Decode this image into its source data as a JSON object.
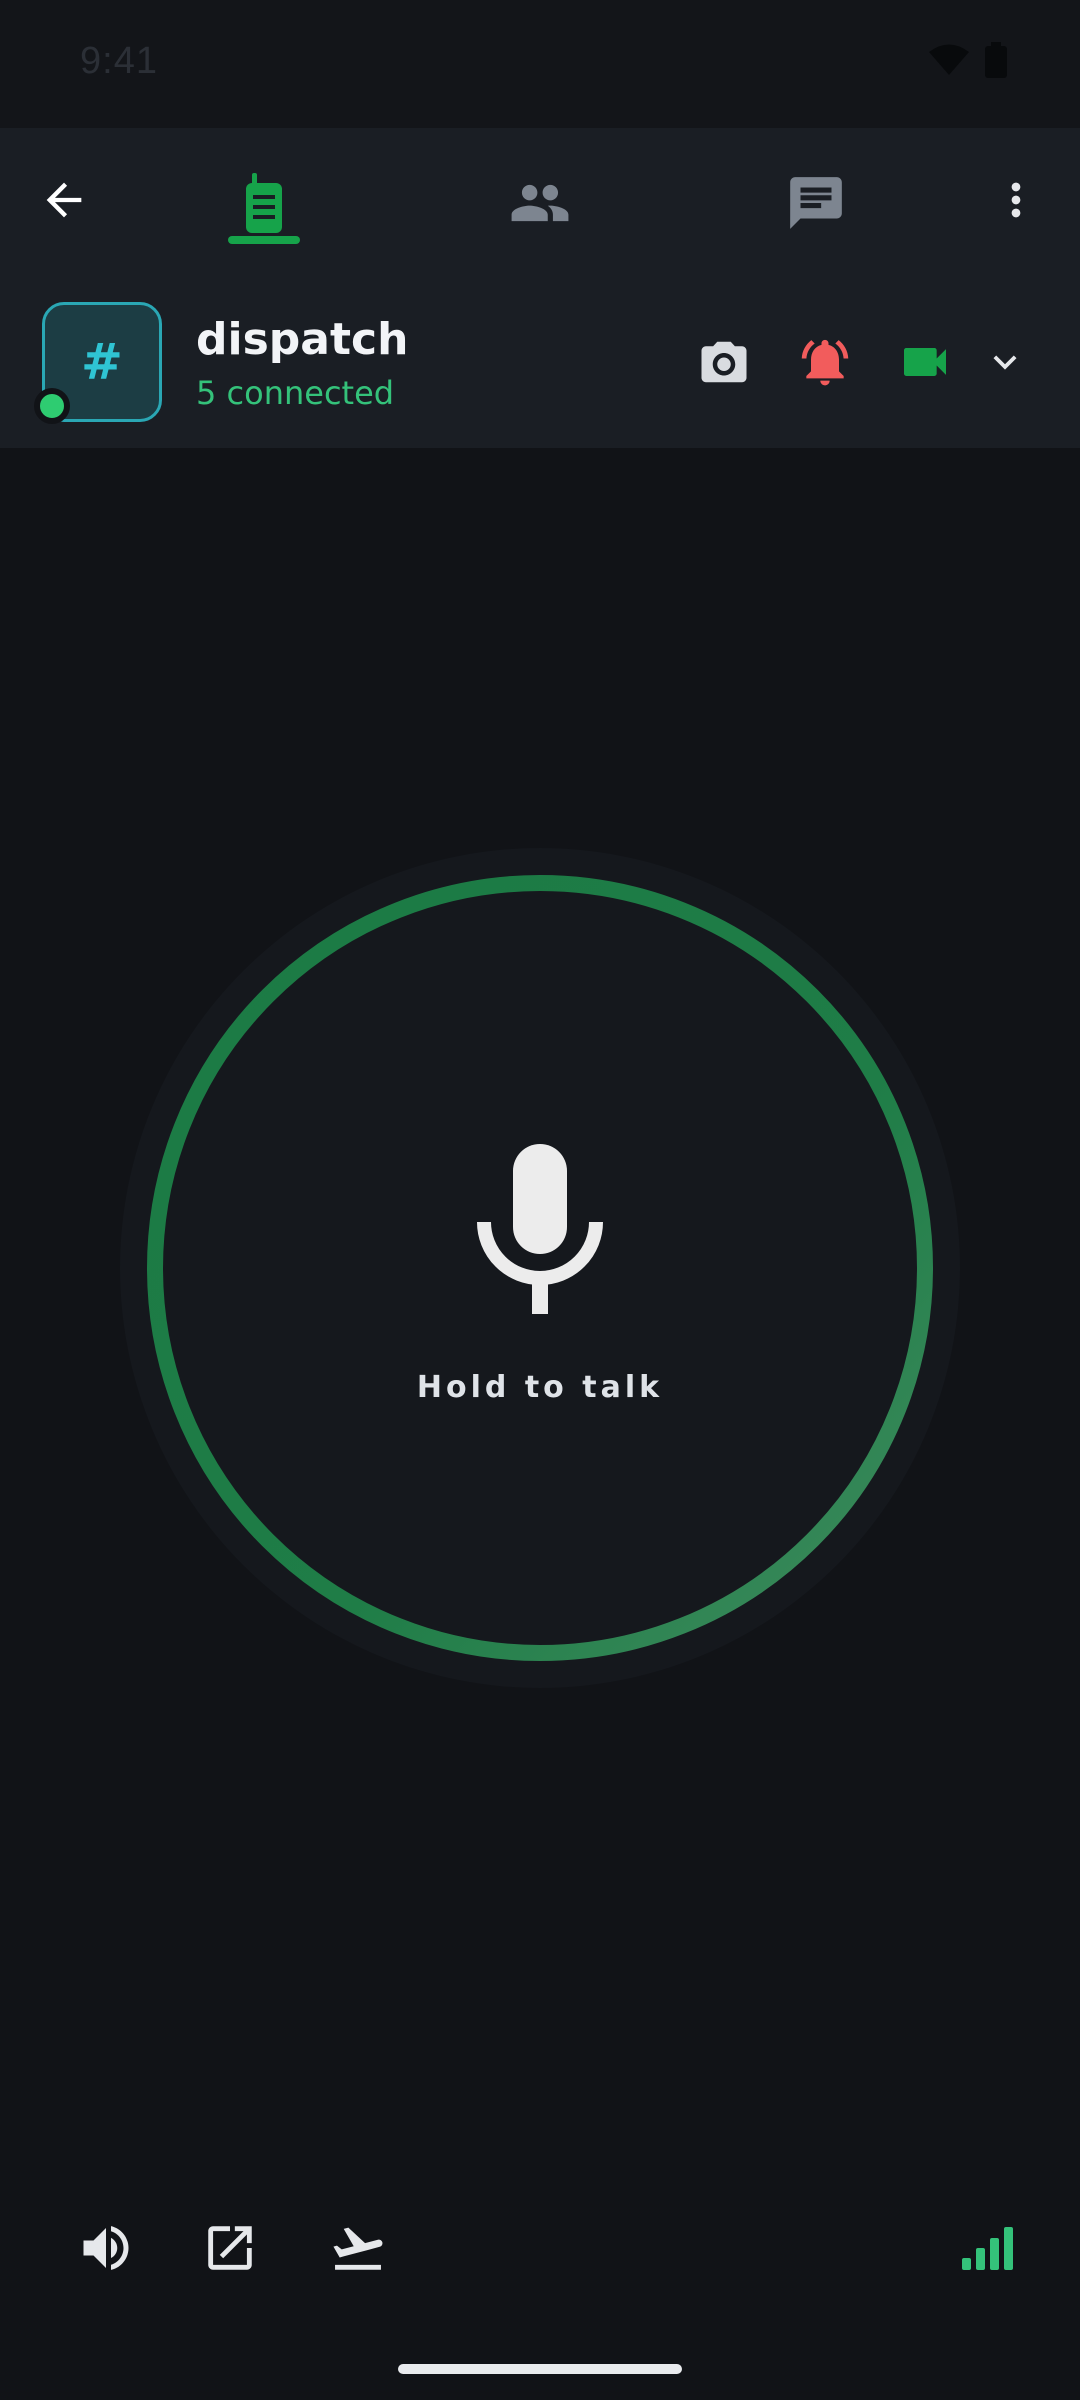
{
  "status_bar": {
    "time": "9:41",
    "icons": [
      "wifi-icon",
      "battery-icon"
    ]
  },
  "nav": {
    "back_icon": "arrow-left-icon",
    "tabs": [
      {
        "icon": "walkie-talkie-icon",
        "active": true
      },
      {
        "icon": "people-icon",
        "active": false
      },
      {
        "icon": "chat-icon",
        "active": false
      }
    ],
    "more_icon": "more-vertical-icon"
  },
  "channel": {
    "symbol": "#",
    "name": "dispatch",
    "status": "5 connected",
    "online": true,
    "actions": [
      "camera-icon",
      "alarm-bell-icon",
      "video-camera-icon",
      "chevron-down-icon"
    ]
  },
  "ptt": {
    "label": "Hold to talk",
    "icon": "microphone-icon"
  },
  "bottom_controls": [
    "speaker-icon",
    "open-external-icon",
    "airplane-departure-icon",
    "signal-strength-icon"
  ],
  "colors": {
    "background": "#111317",
    "bar": "#1a1e24",
    "accent_green": "#16a34a",
    "connected_green": "#34c27a",
    "alert_red": "#f25c5c",
    "channel_teal": "#2fc4d3"
  }
}
